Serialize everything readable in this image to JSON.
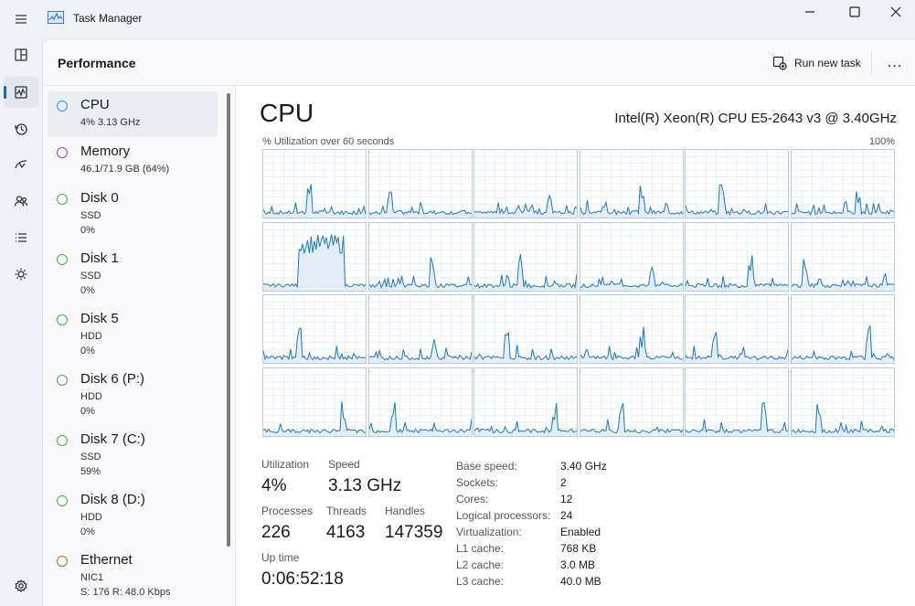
{
  "window": {
    "title": "Task Manager",
    "controls": [
      "minimize",
      "maximize",
      "close"
    ]
  },
  "nav_rail": [
    {
      "name": "hamburger-menu-icon"
    },
    {
      "name": "processes-icon"
    },
    {
      "name": "performance-icon",
      "active": true
    },
    {
      "name": "app-history-icon"
    },
    {
      "name": "startup-apps-icon"
    },
    {
      "name": "users-icon"
    },
    {
      "name": "details-icon"
    },
    {
      "name": "services-icon"
    },
    {
      "name": "settings-icon"
    }
  ],
  "header": {
    "page_title": "Performance",
    "run_new_task": "Run new task",
    "more_label": "..."
  },
  "devices": [
    {
      "name": "CPU",
      "line1": "4%  3.13 GHz",
      "line2": "",
      "color": "#3a8fd6"
    },
    {
      "name": "Memory",
      "line1": "46.1/71.9 GB (64%)",
      "line2": "",
      "color": "#a838b6"
    },
    {
      "name": "Disk 0",
      "line1": "SSD",
      "line2": "0%",
      "color": "#4ca84a"
    },
    {
      "name": "Disk 1",
      "line1": "SSD",
      "line2": "0%",
      "color": "#4ca84a"
    },
    {
      "name": "Disk 5",
      "line1": "HDD",
      "line2": "0%",
      "color": "#4ca84a"
    },
    {
      "name": "Disk 6 (P:)",
      "line1": "HDD",
      "line2": "0%",
      "color": "#4ca84a"
    },
    {
      "name": "Disk 7 (C:)",
      "line1": "SSD",
      "line2": "59%",
      "color": "#4ca84a"
    },
    {
      "name": "Disk 8 (D:)",
      "line1": "HDD",
      "line2": "0%",
      "color": "#4ca84a"
    },
    {
      "name": "Ethernet",
      "line1": "NIC1",
      "line2": "S: 176  R: 48.0 Kbps",
      "color": "#c8692a"
    }
  ],
  "cpu": {
    "title": "CPU",
    "model": "Intel(R) Xeon(R) CPU E5-2643 v3 @ 3.40GHz",
    "graph_label": "% Utilization over 60 seconds",
    "graph_max": "100%",
    "core_count": 24,
    "stats": {
      "utilization_label": "Utilization",
      "utilization": "4%",
      "speed_label": "Speed",
      "speed": "3.13 GHz",
      "processes_label": "Processes",
      "processes": "226",
      "threads_label": "Threads",
      "threads": "4163",
      "handles_label": "Handles",
      "handles": "147359",
      "uptime_label": "Up time",
      "uptime": "0:06:52:18"
    },
    "specs": [
      {
        "label": "Base speed:",
        "value": "3.40 GHz"
      },
      {
        "label": "Sockets:",
        "value": "2"
      },
      {
        "label": "Cores:",
        "value": "12"
      },
      {
        "label": "Logical processors:",
        "value": "24"
      },
      {
        "label": "Virtualization:",
        "value": "Enabled"
      },
      {
        "label": "L1 cache:",
        "value": "768 KB"
      },
      {
        "label": "L2 cache:",
        "value": "3.0 MB"
      },
      {
        "label": "L3 cache:",
        "value": "40.0 MB"
      }
    ]
  },
  "colors": {
    "graph_line": "#1f78b4",
    "graph_fill": "#e4eef8",
    "graph_grid": "#dfe8f1",
    "graph_border": "#b9cde0",
    "accent": "#0f6cbd"
  }
}
